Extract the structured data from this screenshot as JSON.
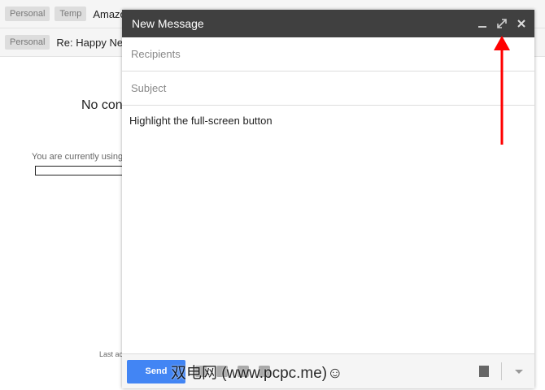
{
  "inbox": {
    "rows": [
      {
        "labels": [
          "Personal",
          "Temp"
        ],
        "subject": "Amazo"
      },
      {
        "labels": [
          "Personal"
        ],
        "subject": "Re: Happy Ne"
      }
    ],
    "no_conversation": "No con",
    "usage_text": "You are currently using",
    "last_activity": "Last ac"
  },
  "compose": {
    "title": "New Message",
    "icons": [
      "minimize-icon",
      "fullscreen-icon",
      "close-icon"
    ],
    "recipients_placeholder": "Recipients",
    "subject_placeholder": "Subject",
    "body": "Highlight the full-screen button",
    "send_label": "Send",
    "watermark": "双电网 (www.pcpc.me)☺"
  },
  "colors": {
    "header": "#404040",
    "send": "#4285f4",
    "annotation_arrow": "#ff0000"
  }
}
